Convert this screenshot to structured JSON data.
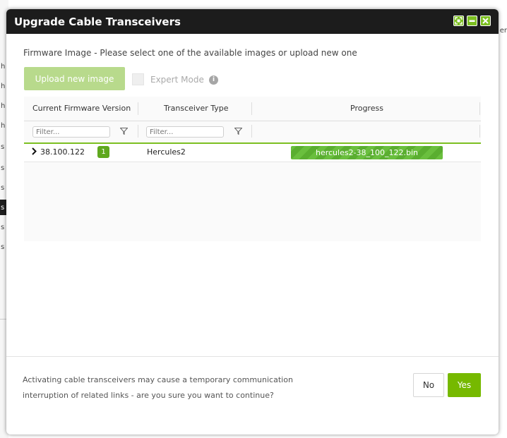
{
  "background": {
    "left_letters": [
      "h",
      "h",
      "h",
      "h",
      "s",
      "s",
      "s",
      "s",
      "s",
      "s"
    ],
    "right_text": "er"
  },
  "dialog": {
    "title": "Upgrade Cable Transceivers",
    "window_buttons": [
      "expand-icon",
      "minimize-icon",
      "close-icon"
    ],
    "subtitle": "Firmware Image - Please select one of the available images or upload new one",
    "upload_button_label": "Upload new image",
    "expert_mode_label": "Expert Mode",
    "expert_mode_checked": false,
    "info_icon_glyph": "i",
    "table": {
      "columns": [
        "Current Firmware Version",
        "Transceiver Type",
        "Progress"
      ],
      "filter_placeholder": "Filter...",
      "rows": [
        {
          "version": "38.100.122",
          "badge": "1",
          "type": "Hercules2",
          "progress_text": "hercules2-38_100_122.bin",
          "progress_percent": 100
        }
      ]
    },
    "confirm_line1": "Activating cable transceivers may cause a temporary communication",
    "confirm_line2": "interruption of related links - are you sure you want to continue?",
    "no_label": "No",
    "yes_label": "Yes"
  },
  "colors": {
    "accent": "#76b900",
    "titlebar": "#1c1c1c",
    "upload_disabled": "#b8da8c"
  }
}
